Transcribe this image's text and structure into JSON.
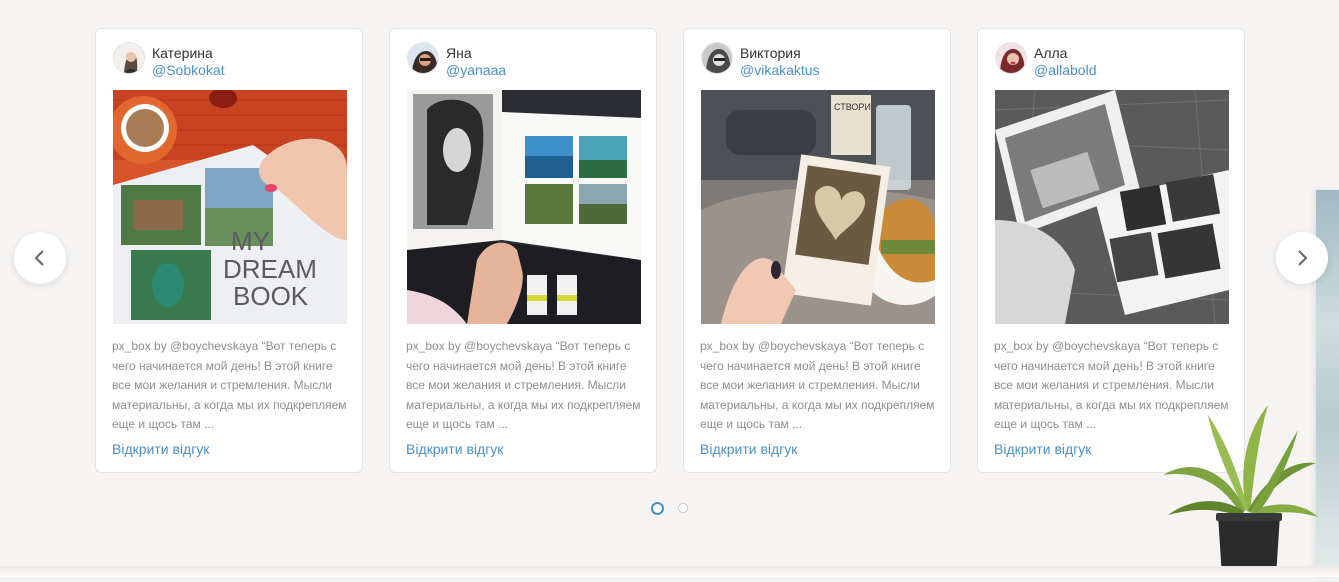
{
  "reviews": [
    {
      "name": "Катерина",
      "handle": "@Sobkokat",
      "description": "px_box by @boychevskaya “Вот теперь с чего начинается мой день! В этой книге все мои желания и стремления. Мысли материальны, а когда мы их подкрепляем еще и щось там ...",
      "link_label": "Відкрити відгук",
      "photo_caption": "MY DREAM BOOK"
    },
    {
      "name": "Яна",
      "handle": "@yanaaa",
      "description": "px_box by @boychevskaya “Вот теперь с чего начинается мой день! В этой книге все мои желания и стремления. Мысли материальны, а когда мы их подкрепляем еще и щось там ...",
      "link_label": "Відкрити відгук"
    },
    {
      "name": "Виктория",
      "handle": "@vikakaktus",
      "description": "px_box by @boychevskaya “Вот теперь с чего начинается мой день! В этой книге все мои желания и стремления. Мысли материальны, а когда мы их подкрепляем еще и щось там ...",
      "link_label": "Відкрити відгук",
      "photo_caption": "СТВОРИ"
    },
    {
      "name": "Алла",
      "handle": "@allabold",
      "description": "px_box by @boychevskaya “Вот теперь с чего начинается мой день! В этой книге все мои желания и стремления. Мысли материальны, а когда мы их подкрепляем еще и щось там ...",
      "link_label": "Відкрити відгук"
    }
  ],
  "carousel": {
    "prev_icon": "chevron-left-icon",
    "next_icon": "chevron-right-icon",
    "pages": 2,
    "active_page": 1
  },
  "colors": {
    "accent": "#4a90c8",
    "text": "#333333",
    "muted": "#8e8e8e",
    "background": "#f6f4f2"
  }
}
